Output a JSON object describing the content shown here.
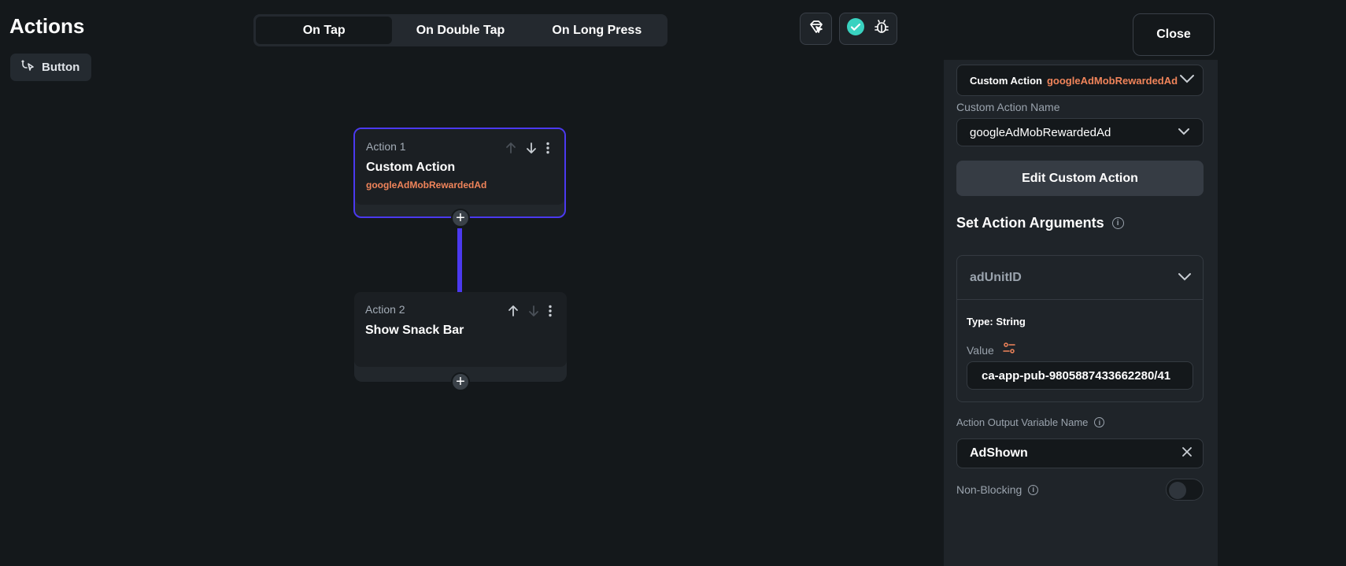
{
  "header": {
    "title": "Actions",
    "widget_chip": "Button",
    "tabs": [
      {
        "label": "On Tap",
        "active": true
      },
      {
        "label": "On Double Tap",
        "active": false
      },
      {
        "label": "On Long Press",
        "active": false
      }
    ],
    "close_label": "Close"
  },
  "actions": [
    {
      "index_label": "Action 1",
      "name": "Custom Action",
      "sub": "googleAdMobRewardedAd",
      "selected": true
    },
    {
      "index_label": "Action 2",
      "name": "Show Snack Bar",
      "sub": "",
      "selected": false
    }
  ],
  "panel": {
    "action_type_label": "Custom Action",
    "action_type_value": "googleAdMobRewardedAd",
    "custom_action_name_label": "Custom Action Name",
    "custom_action_name_value": "googleAdMobRewardedAd",
    "edit_button": "Edit Custom Action",
    "set_args_title": "Set Action Arguments",
    "argument": {
      "name": "adUnitID",
      "type_text": "Type: String",
      "value_label": "Value",
      "value": "ca-app-pub-9805887433662280/41"
    },
    "output_var_label": "Action Output Variable Name",
    "output_var_value": "AdShown",
    "non_blocking_label": "Non-Blocking",
    "non_blocking_on": false
  },
  "colors": {
    "accent": "#4b39ef",
    "orange": "#f0845a",
    "teal": "#39d2c0",
    "background": "#14181b"
  }
}
